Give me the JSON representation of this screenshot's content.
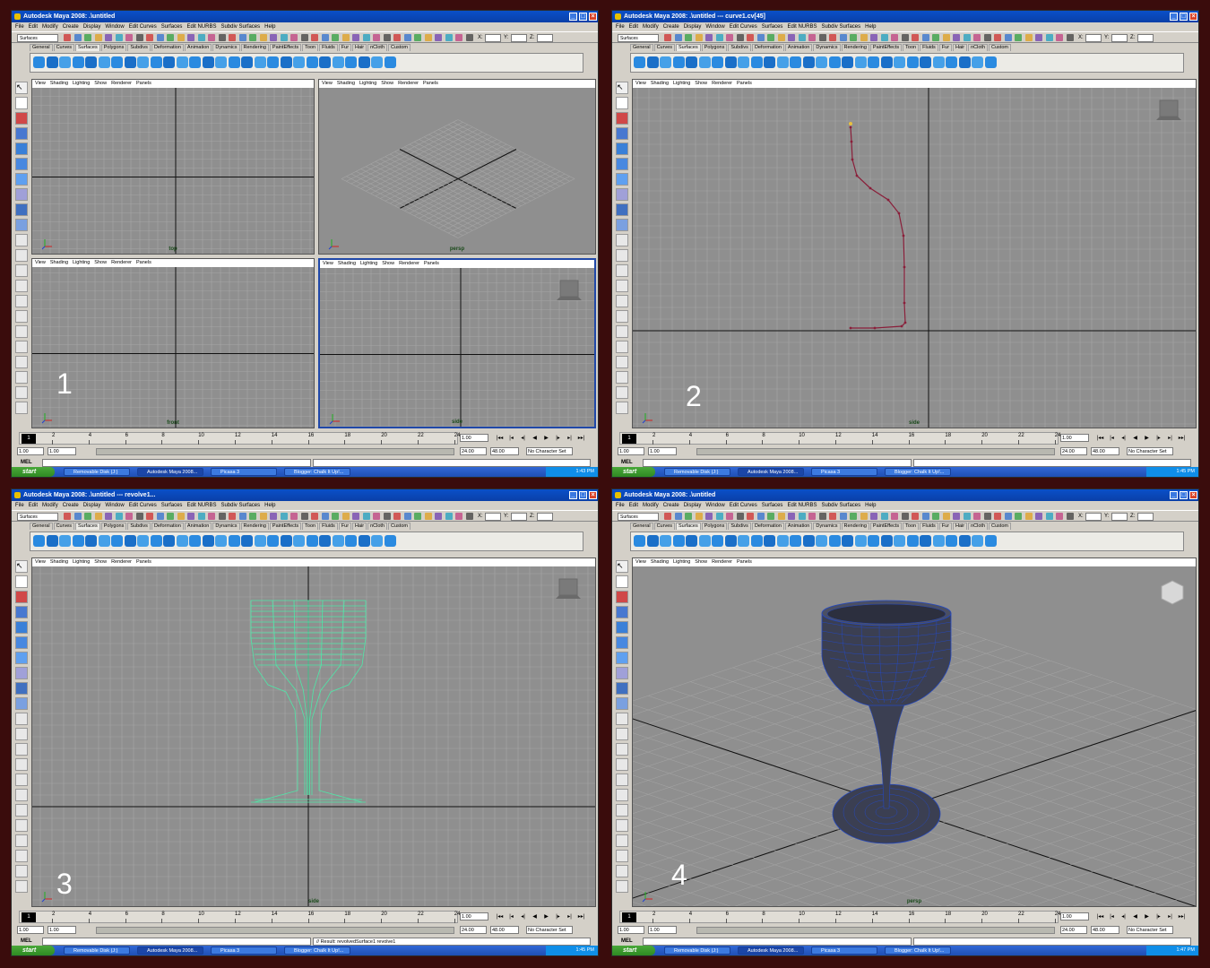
{
  "screens": [
    {
      "title": "Autodesk Maya 2008: .\\untitled",
      "step_number": "1",
      "viewports": [
        "top",
        "persp",
        "front",
        "side"
      ],
      "clock": "1:43 PM",
      "mel_result": ""
    },
    {
      "title": "Autodesk Maya 2008: .\\untitled   ---   curve1.cv[45]",
      "step_number": "2",
      "viewports": [
        "side"
      ],
      "clock": "1:45 PM",
      "mel_result": ""
    },
    {
      "title": "Autodesk Maya 2008: .\\untitled   ---   revolve1...",
      "step_number": "3",
      "viewports": [
        "side"
      ],
      "clock": "1:45 PM",
      "mel_result": "// Result: revolvedSurface1 revolve1"
    },
    {
      "title": "Autodesk Maya 2008: .\\untitled",
      "step_number": "4",
      "viewports": [
        "persp"
      ],
      "clock": "1:47 PM",
      "mel_result": ""
    }
  ],
  "menu": [
    "File",
    "Edit",
    "Modify",
    "Create",
    "Display",
    "Window",
    "Edit Curves",
    "Surfaces",
    "Edit NURBS",
    "Subdiv Surfaces",
    "Help"
  ],
  "menu_set": "Surfaces",
  "xyz_labels": [
    "X:",
    "Y:",
    "Z:"
  ],
  "shelf_tabs": [
    "General",
    "Curves",
    "Surfaces",
    "Polygons",
    "Subdivs",
    "Deformation",
    "Animation",
    "Dynamics",
    "Rendering",
    "PaintEffects",
    "Toon",
    "Fluids",
    "Fur",
    "Hair",
    "nCloth",
    "Custom"
  ],
  "active_shelf_tab": "Surfaces",
  "panel_menu": [
    "View",
    "Shading",
    "Lighting",
    "Show",
    "Renderer",
    "Panels"
  ],
  "timeline": {
    "current_frame": "1",
    "ticks": [
      "2",
      "4",
      "6",
      "8",
      "10",
      "12",
      "14",
      "16",
      "18",
      "20",
      "22",
      "24"
    ],
    "current_time": "1.00",
    "range_start": "1.00",
    "anim_start": "1.00",
    "range_end": "24.00",
    "anim_end": "48.00",
    "character_set": "No Character Set"
  },
  "mel_label": "MEL",
  "taskbar": {
    "start_label": "start",
    "items": [
      "Removable Disk (J:)",
      "Autodesk Maya 2008...",
      "Picasa 3",
      "Blogger: Chalk It Up!..."
    ],
    "active_index": 1
  },
  "colors": {
    "titlebar": "#0a50c8",
    "viewport_bg": "#8f8f8f",
    "grid": "#a6a6a6",
    "axis": "#111111",
    "curve": "#8a1f3a",
    "wireframe": "#4ee8a8",
    "surface": "#3b3f52",
    "isoparm": "#2448c0"
  }
}
